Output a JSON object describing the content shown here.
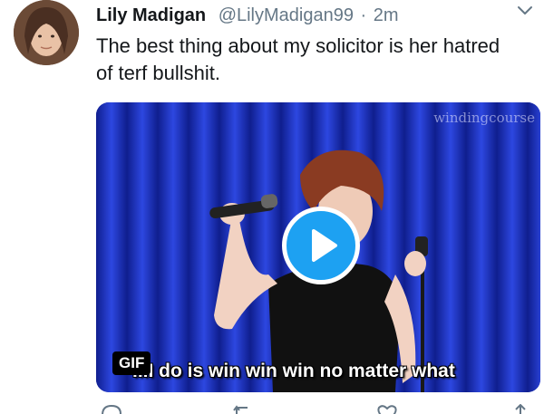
{
  "tweet": {
    "display_name": "Lily Madigan",
    "handle": "@LilyMadigan99",
    "separator": "·",
    "timestamp": "2m",
    "text_line1": "The best thing about my solicitor is her hatred",
    "text_line2": "of terf bullshit."
  },
  "media": {
    "watermark": "windingcourse",
    "caption": "...I do is win win win no matter what",
    "gif_badge": "GIF"
  },
  "colors": {
    "accent": "#1da1f2",
    "secondary_text": "#657786",
    "primary_text": "#14171a",
    "curtain": "#1b2fbf"
  }
}
